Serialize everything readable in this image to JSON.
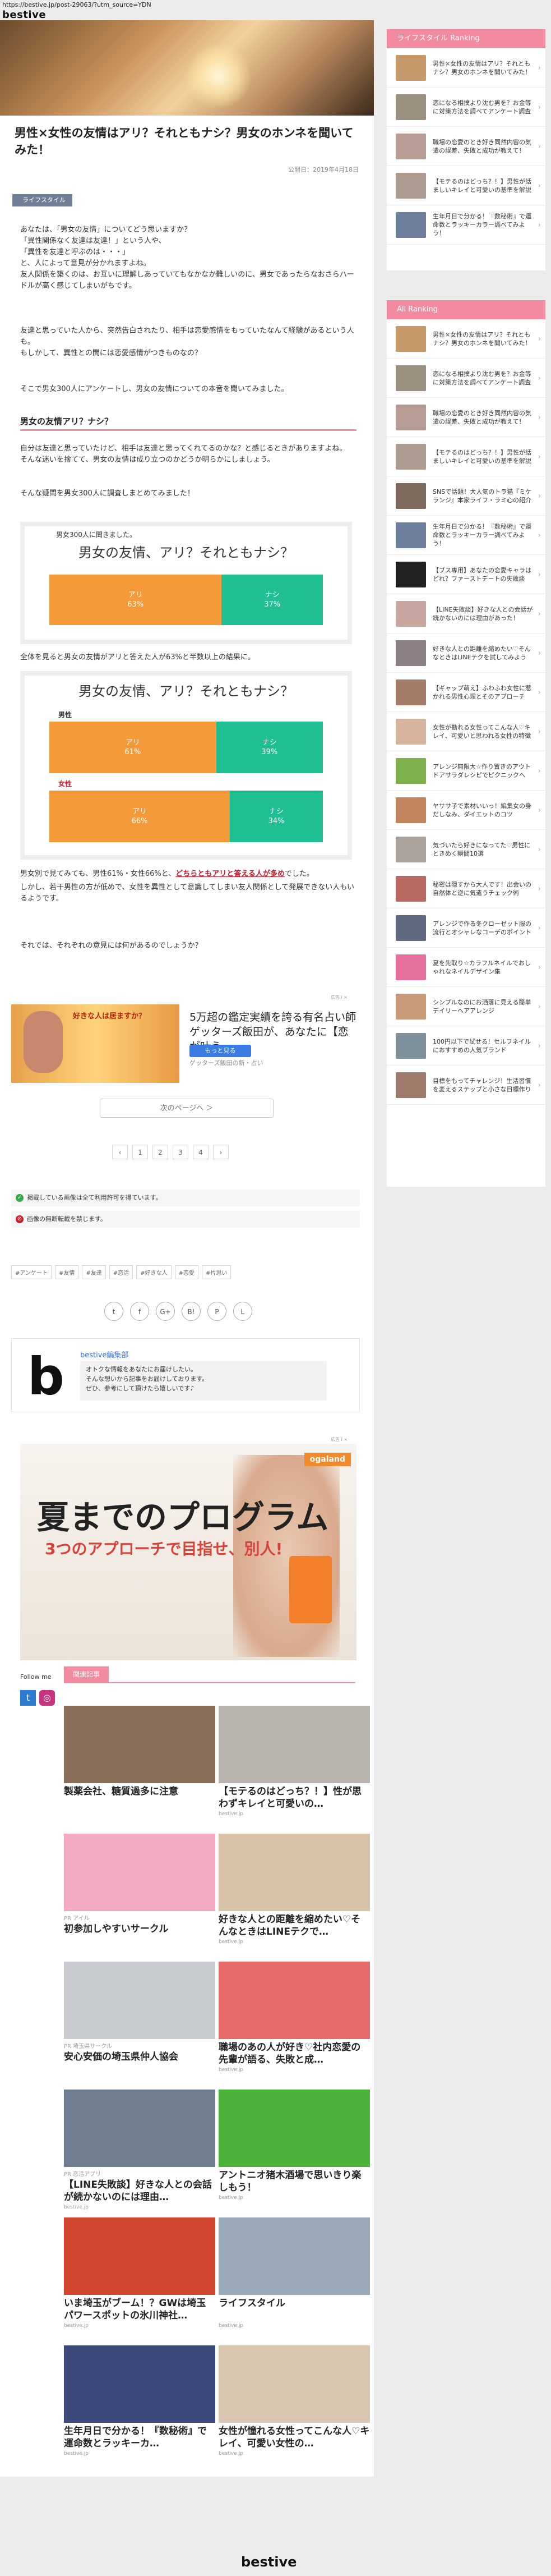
{
  "url": "https://bestive.jp/post-29063/?utm_source=YDN",
  "site_name": "bestive",
  "article": {
    "title": "男性×女性の友情はアリ？それともナシ？男女のホンネを聞いてみた！",
    "date": "公開日：2019年4月18日",
    "category": "ライフスタイル",
    "intro": [
      "あなたは、「男女の友情」についてどう思いますか？",
      "「異性関係なく友達は友達！」という人や、",
      "「異性を友達と呼ぶのは・・・」",
      "と、人によって意見が分かれますよね。",
      "友人関係を築くのは、お互いに理解しあっていてもなかなか難しいのに、男女であったらなおさらハードルが高く感じてしまいがちです。"
    ],
    "intro2": [
      "友達と思っていた人から、突然告白されたり、相手は恋愛感情をもっていたなんて経験があるという人も。",
      "もしかして、異性との間には恋愛感情がつきものなの？"
    ],
    "intro3": "そこで男女300人にアンケートし、男女の友情についての本音を聞いてみました。",
    "h3": "男女の友情アリ？ナシ？",
    "body1": [
      "自分は友達と思っていたけど、相手は友達と思ってくれてるのかな？と感じるときがありますよね。",
      "そんな迷いを捨てて、男女の友情は成り立つのかどうか明らかにしましょう。"
    ],
    "body1b": "そんな疑問を男女300人に調査しまとめてみました！",
    "poll1": {
      "intro": "男女300人に聞きました。",
      "question": "男女の友情、アリ？それともナシ？",
      "yes_label": "アリ",
      "yes_value": "63%",
      "no_label": "ナシ",
      "no_value": "37%",
      "yes_pct": 63
    },
    "after_poll1": "全体を見ると男女の友情がアリと答えた人が63%と半数以上の結果に。",
    "poll2": {
      "question": "男女の友情、アリ？それともナシ？",
      "male_label": "男性",
      "male_yes": "アリ",
      "male_yes_value": "61%",
      "male_no": "ナシ",
      "male_no_value": "39%",
      "male_pct": 61,
      "female_label": "女性",
      "female_yes": "アリ",
      "female_yes_value": "66%",
      "female_no": "ナシ",
      "female_no_value": "34%",
      "female_pct": 66
    },
    "body2_pre": "男女別で見てみても、男性61%・女性66%と、",
    "body2_red": "どちらともアリと答える人が多め",
    "body2_post": "でした。",
    "body3": "しかし、若干男性の方が低めで、女性を異性として意識してしまい友人関係として発展できない人もいるようです。",
    "body4": "それでは、それぞれの意見には何があるのでしょうか？"
  },
  "ad1": {
    "title": "5万超の鑑定実績を誇る有名占い師ゲッターズ飯田が、あなたに【恋が叶う…",
    "button": "もっと見る",
    "sponsor": "ゲッターズ飯田の新・占い",
    "image_text": "好きな人は居ますか？",
    "mark": "広告 i ×"
  },
  "next_page": "次のページへ ＞",
  "pager": [
    "‹",
    "1",
    "2",
    "3",
    "4",
    "›"
  ],
  "notes": [
    {
      "icon": "✓",
      "color": "#39a84a",
      "text": "掲載している画像は全て利用許可を得ています。"
    },
    {
      "icon": "⊘",
      "color": "#d0182b",
      "text": "画像の無断転載を禁じます。"
    }
  ],
  "tags": [
    "#アンケート",
    "#友情",
    "#友達",
    "#恋活",
    "#好きな人",
    "#恋愛",
    "#片思い"
  ],
  "share": [
    "t",
    "f",
    "G+",
    "B!",
    "P",
    "L"
  ],
  "author": {
    "logo_letter": "b",
    "name": "bestive編集部",
    "bio": [
      "オトクな情報をあなたにお届けしたい。",
      "そんな想いから記事をお届けしております。",
      "ぜひ、参考にして頂けたら嬉しいです♪"
    ]
  },
  "ad2": {
    "brand": "ogaland",
    "headline": "夏までのプログラム",
    "sub": "3つのアプローチで目指せ、別人!",
    "mark": "広告 i ×"
  },
  "follow_label": "Follow me",
  "related_label": "関連記事",
  "related": [
    {
      "cat": "",
      "title": "製薬会社、糖質過多に注意",
      "source": "",
      "color": "#8a6f5a"
    },
    {
      "cat": "",
      "title": "【モテるのはどっち？！】性が思わずキレイと可愛いの…",
      "source": "bestive.jp",
      "color": "#b9b3ae"
    },
    {
      "cat": "PR アイル",
      "title": "初参加しやすいサークル",
      "source": "",
      "color": "#f3a9c2"
    },
    {
      "cat": "",
      "title": "好きな人との距離を縮めたい♡そんなときはLINEテクで…",
      "source": "bestive.jp",
      "color": "#d8c3a8"
    },
    {
      "cat": "PR 埼玉県サークル",
      "title": "安心安価の埼玉県仲人協会",
      "source": "",
      "color": "#c9cdd2"
    },
    {
      "cat": "",
      "title": "職場のあの人が好き♡社内恋愛の先輩が語る、失敗と成…",
      "source": "bestive.jp",
      "color": "#e56b6b"
    },
    {
      "cat": "PR 恋活アプリ",
      "title": "【LINE失敗談】好きな人との会話が続かないのには理由…",
      "source": "bestive.jp",
      "color": "#6f7f90"
    },
    {
      "cat": "",
      "title": "アントニオ猪木酒場で思いきり楽しもう！",
      "source": "bestive.jp",
      "color": "#4bb33a"
    },
    {
      "cat": "",
      "title": "いま埼玉がブーム！？GWは埼玉パワースポットの氷川神社…",
      "source": "bestive.jp",
      "color": "#d2452e"
    },
    {
      "cat": "",
      "title": "ライフスタイル",
      "source": "bestive.jp",
      "color": "#99a9b8"
    },
    {
      "cat": "",
      "title": "生年月日で分かる！『数秘術』で運命数とラッキーカ…",
      "source": "bestive.jp",
      "color": "#3b4a7a"
    },
    {
      "cat": "",
      "title": "女性が憧れる女性ってこんな人♡キレイ、可愛い女性の…",
      "source": "bestive.jp",
      "color": "#d9c6b0"
    }
  ],
  "sidebar1": {
    "title": "ライフスタイル Ranking",
    "items": [
      {
        "text": "男性×女性の友情はアリ？それともナシ？男女のホンネを聞いてみた！",
        "color": "#c79a6b"
      },
      {
        "text": "恋になる相撲より沈む男を？お金等に対策方法を調べてアンケート調査",
        "color": "#9b8f7f"
      },
      {
        "text": "職場の恋愛のとき好き同然内容の気遣の誤差、失敗と成功が教えて！",
        "color": "#b69c93"
      },
      {
        "text": "【モテるのはどっち？！】男性が話ましいキレイと可愛いの基準を解説",
        "color": "#ad9b90"
      },
      {
        "text": "生年月日で分かる！『数秘術』で運命数とラッキーカラー調べてみよう！",
        "color": "#6d7f9d"
      }
    ]
  },
  "sidebar2": {
    "title": "All Ranking",
    "items": [
      {
        "text": "男性×女性の友情はアリ？それともナシ？男女のホンネを聞いてみた！",
        "color": "#c79a6b"
      },
      {
        "text": "恋になる相撲より沈む男を？お金等に対策方法を調べてアンケート調査",
        "color": "#9b8f7f"
      },
      {
        "text": "職場の恋愛のとき好き同然内容の気遣の誤差、失敗と成功が教えて！",
        "color": "#b69c93"
      },
      {
        "text": "【モテるのはどっち？！】男性が話ましいキレイと可愛いの基準を解説",
        "color": "#ad9b90"
      },
      {
        "text": "SNSで話題！大人気のトラ猫『ミケランジ』本家ライフ・ラミ心の紹介",
        "color": "#7e6a5c"
      },
      {
        "text": "生年月日で分かる！『数秘術』で運命数とラッキーカラー調べてみよう！",
        "color": "#6d7f9d"
      },
      {
        "text": "【ブス専用】あなたの恋愛キャラはどれ？ファーストデートの失敗談",
        "color": "#222222"
      },
      {
        "text": "【LINE失敗談】好きな人との会話が続かないのには理由があった！",
        "color": "#c9a7a0"
      },
      {
        "text": "好きな人との距離を縮めたい♡そんなときはLINEテクを試してみよう",
        "color": "#8c7f83"
      },
      {
        "text": "【ギャップ萌え】ふわふわ女性に惹かれる男性心理とそのアプローチ",
        "color": "#a57c69"
      },
      {
        "text": "女性が勘れる女性ってこんな人♡キレイ、可愛いと思われる女性の特徴",
        "color": "#d6b49e"
      },
      {
        "text": "アレンジ無限大☆作り置きのアウトドアサラダレシピでピクニックへ",
        "color": "#7db04b"
      },
      {
        "text": "ヤササ子で素材いいっ！編集女の身だしなみ、ダイエットのコツ",
        "color": "#c2855f"
      },
      {
        "text": "気づいたら好きになってた♡男性にときめく瞬間10選",
        "color": "#a9a19a"
      },
      {
        "text": "秘密は隠すから大人です！出会いの自然体と逆に気遣うチェック術",
        "color": "#b86a62"
      },
      {
        "text": "アレンジで作る冬クローゼット服の流行とオシャレなコーデのポイント",
        "color": "#5f6a80"
      },
      {
        "text": "夏を先取り☆カラフルネイルでおしゃれなネイルデザイン集",
        "color": "#e46f9c"
      },
      {
        "text": "シンプルなのにお洒落に見える簡単デイリーヘアアレンジ",
        "color": "#c99a78"
      },
      {
        "text": "100円以下で試せる！セルフネイルにおすすめの人気ブランド",
        "color": "#7e8f9c"
      },
      {
        "text": "目標をもってチャレンジ！生活習慣を変えるステップと小さな目標作り",
        "color": "#9d7a6a"
      }
    ]
  },
  "footer_logo": "bestive"
}
